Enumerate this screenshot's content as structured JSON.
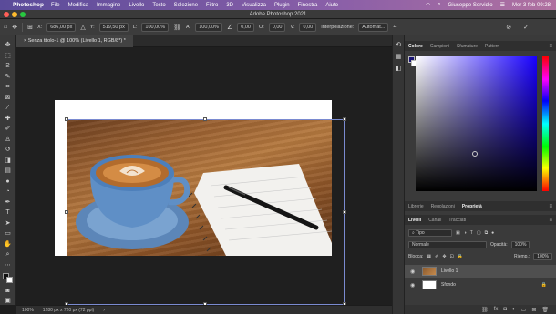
{
  "menubar": {
    "apple": "",
    "app": "Photoshop",
    "items": [
      "File",
      "Modifica",
      "Immagine",
      "Livello",
      "Testo",
      "Selezione",
      "Filtro",
      "3D",
      "Visualizza",
      "Plugin",
      "Finestra",
      "Aiuto"
    ],
    "user": "Giuseppe Servidio",
    "datetime": "Mer 3 feb  09:28"
  },
  "window": {
    "title": "Adobe Photoshop 2021",
    "traffic_colors": [
      "#ff5f57",
      "#febc2e",
      "#28c840"
    ]
  },
  "options": {
    "x_label": "X:",
    "x_value": "686,00 px",
    "y_label": "Y:",
    "y_value": "519,50 px",
    "w_label": "L:",
    "w_value": "100,00%",
    "h_label": "A:",
    "h_value": "100,00%",
    "angle_value": "0,00",
    "h_skew_label": "O:",
    "h_skew_value": "0,00",
    "v_skew_label": "V:",
    "v_skew_value": "0,00",
    "interp_label": "Interpolazione:",
    "interp_value": "Automat...",
    "cancel_icon": "cancel-icon",
    "commit_icon": "check-icon"
  },
  "document": {
    "tab_label": "Senza titolo-1 @ 100% (Livello 1, RGB/8*) *"
  },
  "status": {
    "zoom": "100%",
    "size": "1280 px x 720 px (72 ppi)"
  },
  "color_panel": {
    "tabs": [
      "Colore",
      "Campioni",
      "Sfumature",
      "Pattern"
    ],
    "foreground": "#1a1575",
    "background": "#ffffff"
  },
  "props_panel": {
    "tabs": [
      "Librerie",
      "Regolazioni",
      "Proprietà"
    ]
  },
  "layers_panel": {
    "tabs": [
      "Livelli",
      "Canali",
      "Tracciati"
    ],
    "filter_value": "Tipo",
    "blend_mode": "Normale",
    "opacity_label": "Opacità:",
    "opacity_value": "100%",
    "lock_label": "Blocca:",
    "fill_label": "Riemp.:",
    "fill_value": "100%",
    "layers": [
      {
        "name": "Livello 1",
        "selected": true
      },
      {
        "name": "Sfondo",
        "selected": false
      }
    ]
  }
}
